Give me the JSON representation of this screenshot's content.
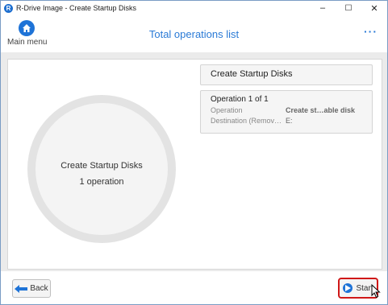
{
  "window": {
    "title": "R-Drive Image - Create Startup Disks",
    "app_icon_glyph": "R",
    "controls": {
      "minimize": "–",
      "maximize": "☐",
      "close": "✕"
    }
  },
  "header": {
    "main_menu_label": "Main menu",
    "page_title": "Total operations list",
    "more": "···"
  },
  "summary": {
    "title": "Create Startup Disks",
    "count_text": "1 operation"
  },
  "operations_header": "Create Startup Disks",
  "operation": {
    "title": "Operation 1 of 1",
    "rows": [
      {
        "key": "Operation",
        "value": "Create st…able disk"
      },
      {
        "key": "Destination (Remov…",
        "value": "E:"
      }
    ]
  },
  "footer": {
    "back_label": "Back",
    "start_label": "Start"
  },
  "colors": {
    "accent": "#1e73d7",
    "highlight_border": "#d01818"
  },
  "icons": [
    "app-logo-icon",
    "home-icon",
    "more-icon",
    "back-arrow-icon",
    "play-icon",
    "mouse-cursor-icon"
  ]
}
